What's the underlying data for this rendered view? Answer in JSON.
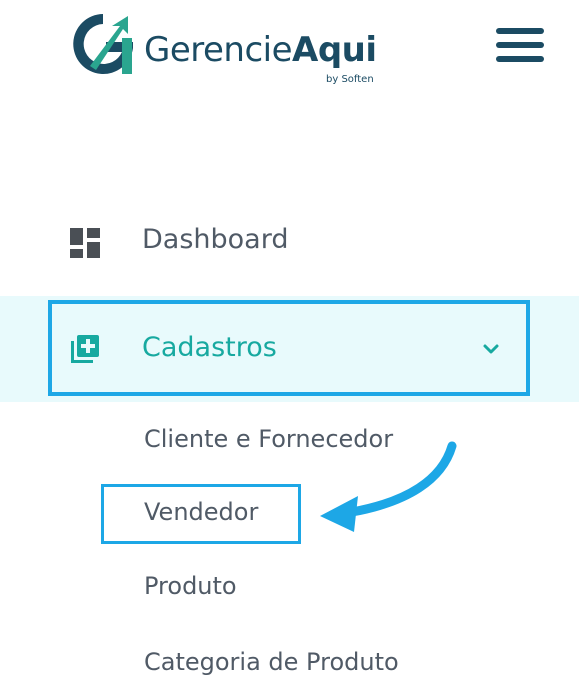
{
  "brand": {
    "name_regular": "Gerencie",
    "name_bold": "Aqui",
    "byline": "by Soften"
  },
  "menu": {
    "dashboard": {
      "label": "Dashboard",
      "icon": "dashboard-icon"
    },
    "cadastros": {
      "label": "Cadastros",
      "icon": "add-box-icon",
      "expanded": true,
      "accent": "#17a9a0",
      "subitems": {
        "cliente": "Cliente e Fornecedor",
        "vendedor": "Vendedor",
        "produto": "Produto",
        "categoria": "Categoria de Produto"
      }
    }
  },
  "colors": {
    "brand_dark": "#1b4b63",
    "brand_accent": "#2aa58f",
    "highlight_border": "#1da7e6",
    "active_bg": "#e8fafc"
  }
}
